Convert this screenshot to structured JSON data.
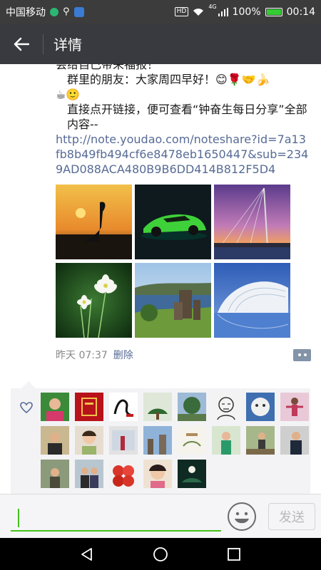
{
  "status_bar": {
    "carrier": "中国移动",
    "network": "4G",
    "battery": "100%",
    "time": "00:14"
  },
  "app_bar": {
    "title": "详情"
  },
  "post": {
    "line_top": "会给自己带来福报！",
    "greeting": "群里的朋友：大家周四早好！😊🌹🤝🍌",
    "emoji_line": "☕🙂",
    "instruction": "直接点开链接，便可查看“钟奋生每日分享”全部内容--",
    "link": "http://note.youdao.com/noteshare?id=7a13fb8b49fb494cf6e8478eb1650447&sub=2349AD088ACA480B9B6DD414B812F5D4",
    "photos": [
      {
        "name": "sunset-crane-photo"
      },
      {
        "name": "green-sports-car-photo"
      },
      {
        "name": "bridge-purple-sky-photo"
      },
      {
        "name": "white-flowers-photo"
      },
      {
        "name": "castle-lake-photo"
      },
      {
        "name": "modern-building-photo"
      }
    ],
    "time": "昨天 07:37",
    "delete_label": "删除"
  },
  "likes": {
    "count": 21
  },
  "comment_bar": {
    "placeholder": "",
    "send_label": "发送"
  },
  "colors": {
    "status_bg": "#3c3c3c",
    "app_bar_bg": "#393a3f",
    "link": "#576b95",
    "accent": "#45c01a",
    "likes_bg": "#f3f3f5"
  }
}
